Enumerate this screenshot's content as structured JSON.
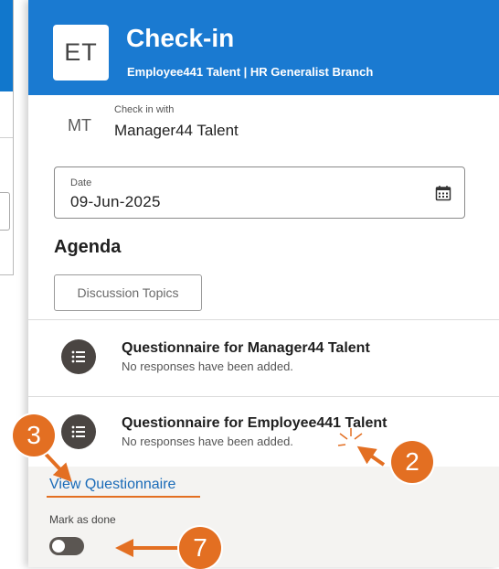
{
  "header": {
    "avatar_initials": "ET",
    "title": "Check-in",
    "subtitle": "Employee441 Talent | HR Generalist Branch"
  },
  "checkin_with": {
    "avatar_initials": "MT",
    "caption": "Check in with",
    "name": "Manager44 Talent"
  },
  "date_field": {
    "label": "Date",
    "value": "09-Jun-2025",
    "icon": "calendar-icon"
  },
  "agenda": {
    "title": "Agenda",
    "discussion_topics_label": "Discussion Topics",
    "questionnaires": [
      {
        "title": "Questionnaire for Manager44 Talent",
        "status": "No responses have been added."
      },
      {
        "title": "Questionnaire for Employee441 Talent",
        "status": "No responses have been added."
      }
    ],
    "view_questionnaire_label": "View Questionnaire",
    "mark_as_done_label": "Mark as done"
  },
  "callouts": {
    "view_questionnaire": "3",
    "status_text": "2",
    "mark_as_done": "7"
  },
  "colors": {
    "header_blue": "#1a7ad1",
    "callout_orange": "#e36f22",
    "link_blue": "#1a6bb8"
  }
}
